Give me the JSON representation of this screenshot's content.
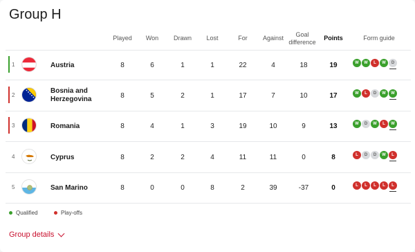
{
  "title": "Group H",
  "headers": {
    "played": "Played",
    "won": "Won",
    "drawn": "Drawn",
    "lost": "Lost",
    "for": "For",
    "against": "Against",
    "goal_diff_1": "Goal",
    "goal_diff_2": "difference",
    "points": "Points",
    "form": "Form guide"
  },
  "rows": [
    {
      "pos": "1",
      "team": "Austria",
      "team2": "",
      "played": "8",
      "won": "6",
      "drawn": "1",
      "lost": "1",
      "for": "22",
      "against": "4",
      "gd": "18",
      "points": "19",
      "status_color": "#3aa02c",
      "form": [
        "W",
        "W",
        "L",
        "W",
        "D"
      ]
    },
    {
      "pos": "2",
      "team": "Bosnia and",
      "team2": "Herzegovina",
      "played": "8",
      "won": "5",
      "drawn": "2",
      "lost": "1",
      "for": "17",
      "against": "7",
      "gd": "10",
      "points": "17",
      "status_color": "#d0302c",
      "form": [
        "W",
        "L",
        "D",
        "W",
        "W"
      ]
    },
    {
      "pos": "3",
      "team": "Romania",
      "team2": "",
      "played": "8",
      "won": "4",
      "drawn": "1",
      "lost": "3",
      "for": "19",
      "against": "10",
      "gd": "9",
      "points": "13",
      "status_color": "#d0302c",
      "form": [
        "W",
        "D",
        "W",
        "L",
        "W"
      ]
    },
    {
      "pos": "4",
      "team": "Cyprus",
      "team2": "",
      "played": "8",
      "won": "2",
      "drawn": "2",
      "lost": "4",
      "for": "11",
      "against": "11",
      "gd": "0",
      "points": "8",
      "status_color": "",
      "form": [
        "L",
        "D",
        "D",
        "W",
        "L"
      ]
    },
    {
      "pos": "5",
      "team": "San Marino",
      "team2": "",
      "played": "8",
      "won": "0",
      "drawn": "0",
      "lost": "8",
      "for": "2",
      "against": "39",
      "gd": "-37",
      "points": "0",
      "status_color": "",
      "form": [
        "L",
        "L",
        "L",
        "L",
        "L"
      ]
    }
  ],
  "legend": {
    "qualified": "Qualified",
    "qualified_color": "#3aa02c",
    "playoffs": "Play-offs",
    "playoffs_color": "#d0302c"
  },
  "group_details": "Group details"
}
